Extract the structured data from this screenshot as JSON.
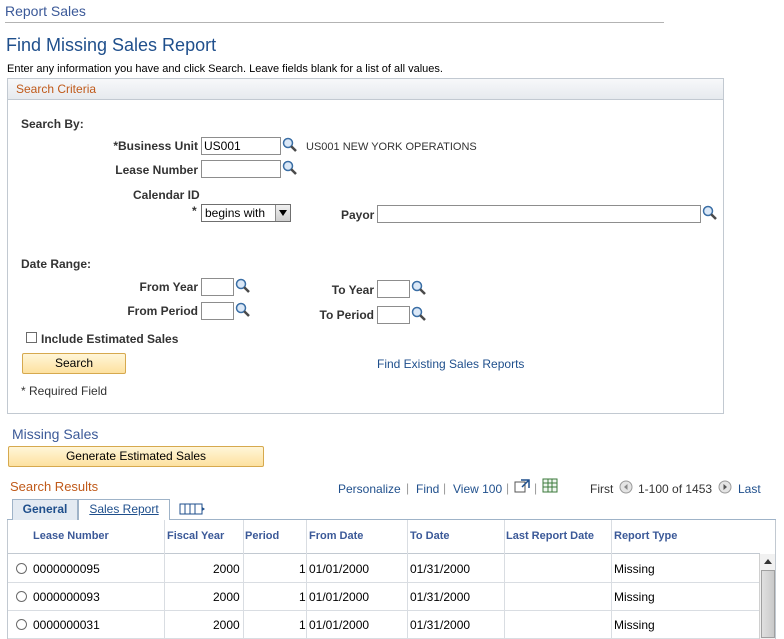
{
  "header": {
    "breadcrumb": "Report Sales",
    "title": "Find Missing Sales Report",
    "instructions": "Enter any information you have and click Search. Leave fields blank for a list of all values."
  },
  "search_criteria": {
    "title": "Search Criteria",
    "search_by_label": "Search By:",
    "business_unit_label": "*Business Unit",
    "business_unit_value": "US001",
    "business_unit_desc": "US001 NEW YORK OPERATIONS",
    "lease_number_label": "Lease Number",
    "lease_number_value": "",
    "calendar_id_label": "Calendar ID",
    "calendar_required_mark": "*",
    "calendar_operator": "begins with",
    "payor_label": "Payor",
    "payor_value": "",
    "date_range_label": "Date Range:",
    "from_year_label": "From Year",
    "to_year_label": "To Year",
    "from_period_label": "From Period",
    "to_period_label": "To Period",
    "include_estimated_label": "Include Estimated Sales",
    "search_button": "Search",
    "find_existing_link": "Find Existing Sales Reports",
    "required_note": "* Required Field"
  },
  "missing_sales": {
    "title": "Missing Sales",
    "generate_button": "Generate Estimated Sales"
  },
  "results": {
    "title": "Search Results",
    "personalize": "Personalize",
    "find": "Find",
    "view100": "View 100",
    "first": "First",
    "range": "1-100 of 1453",
    "last": "Last",
    "tabs": [
      "General",
      "Sales Report"
    ],
    "columns": [
      "Lease Number",
      "Fiscal Year",
      "Period",
      "From Date",
      "To Date",
      "Last Report Date",
      "Report Type"
    ],
    "rows": [
      {
        "lease": "0000000095",
        "year": "2000",
        "period": "1",
        "from": "01/01/2000",
        "to": "01/31/2000",
        "last": "",
        "type": "Missing"
      },
      {
        "lease": "0000000093",
        "year": "2000",
        "period": "1",
        "from": "01/01/2000",
        "to": "01/31/2000",
        "last": "",
        "type": "Missing"
      },
      {
        "lease": "0000000031",
        "year": "2000",
        "period": "1",
        "from": "01/01/2000",
        "to": "01/31/2000",
        "last": "",
        "type": "Missing"
      }
    ]
  },
  "colors": {
    "accent": "#1f4f8c",
    "section_header": "#c05a1a",
    "button_fill": "#fde1a0"
  },
  "icons": {
    "lookup": "magnifier-icon",
    "prev": "circle-left-arrow-icon",
    "next": "circle-right-arrow-icon",
    "download": "spreadsheet-icon",
    "zoom": "popout-icon",
    "show_all_columns": "show-all-columns-icon"
  }
}
